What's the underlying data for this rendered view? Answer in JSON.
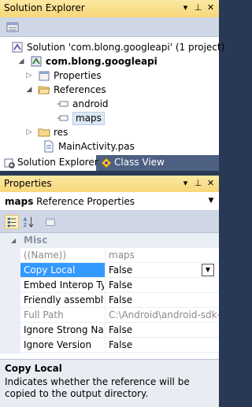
{
  "solution_explorer": {
    "title": "Solution Explorer",
    "tree": {
      "solution": "Solution 'com.blong.googleapi' (1 project)",
      "project": "com.blong.googleapi",
      "properties": "Properties",
      "references": "References",
      "ref_android": "android",
      "ref_maps": "maps",
      "res": "res",
      "mainactivity": "MainActivity.pas"
    },
    "tabs": {
      "solution_explorer": "Solution Explorer",
      "class_view": "Class View"
    }
  },
  "properties_panel": {
    "title": "Properties",
    "object_name": "maps",
    "object_type": "Reference Properties",
    "category": "Misc",
    "rows": [
      {
        "name": "((Name))",
        "value": "maps"
      },
      {
        "name": "Copy Local",
        "value": "False"
      },
      {
        "name": "Embed Interop Type",
        "value": "False"
      },
      {
        "name": "Friendly assembly",
        "value": "False"
      },
      {
        "name": "Full Path",
        "value": "C:\\Android\\android-sdk-w"
      },
      {
        "name": "Ignore Strong Name",
        "value": "False"
      },
      {
        "name": "Ignore Version",
        "value": "False"
      }
    ],
    "description": {
      "title": "Copy Local",
      "text": "Indicates whether the reference will be copied to the output directory."
    }
  }
}
